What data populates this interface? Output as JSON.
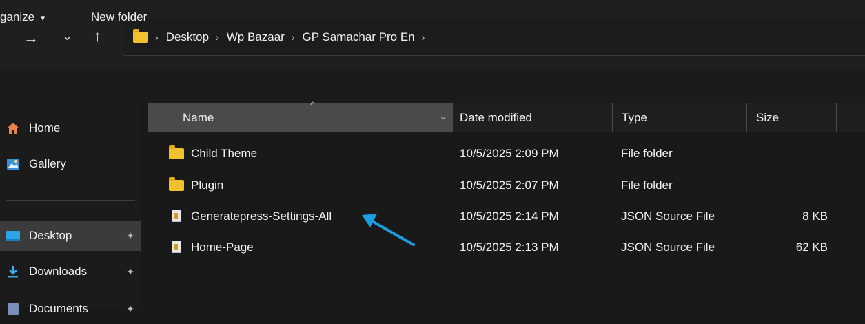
{
  "nav": {
    "forward_glyph": "→",
    "recent_glyph": "⌄",
    "up_glyph": "↑"
  },
  "address": {
    "crumbs": [
      "Desktop",
      "Wp Bazaar",
      "GP Samachar Pro En"
    ],
    "separator": "›"
  },
  "toolbar": {
    "organize_label": "ganize",
    "organize_caret": "▾",
    "new_folder_label": "New folder"
  },
  "sidebar": {
    "items": [
      {
        "label": "Home",
        "icon": "home-icon"
      },
      {
        "label": "Gallery",
        "icon": "gallery-icon"
      },
      {
        "label": "Desktop",
        "icon": "desktop-icon"
      },
      {
        "label": "Downloads",
        "icon": "download-icon"
      },
      {
        "label": "Documents",
        "icon": "documents-icon"
      }
    ],
    "pin_glyph": "📌"
  },
  "columns": {
    "name": "Name",
    "date": "Date modified",
    "type": "Type",
    "size": "Size"
  },
  "files": [
    {
      "name": "Child Theme",
      "date": "10/5/2025 2:09 PM",
      "type": "File folder",
      "size": "",
      "icon": "folder-icon"
    },
    {
      "name": "Plugin",
      "date": "10/5/2025 2:07 PM",
      "type": "File folder",
      "size": "",
      "icon": "folder-icon"
    },
    {
      "name": "Generatepress-Settings-All",
      "date": "10/5/2025 2:14 PM",
      "type": "JSON Source File",
      "size": "8 KB",
      "icon": "json-file-icon"
    },
    {
      "name": "Home-Page",
      "date": "10/5/2025 2:13 PM",
      "type": "JSON Source File",
      "size": "62 KB",
      "icon": "json-file-icon"
    }
  ],
  "colors": {
    "arrow": "#1a9ee0",
    "folder": "#f2c12e",
    "desktop_icon": "#2aa6e8",
    "download_icon": "#37b3f0"
  }
}
